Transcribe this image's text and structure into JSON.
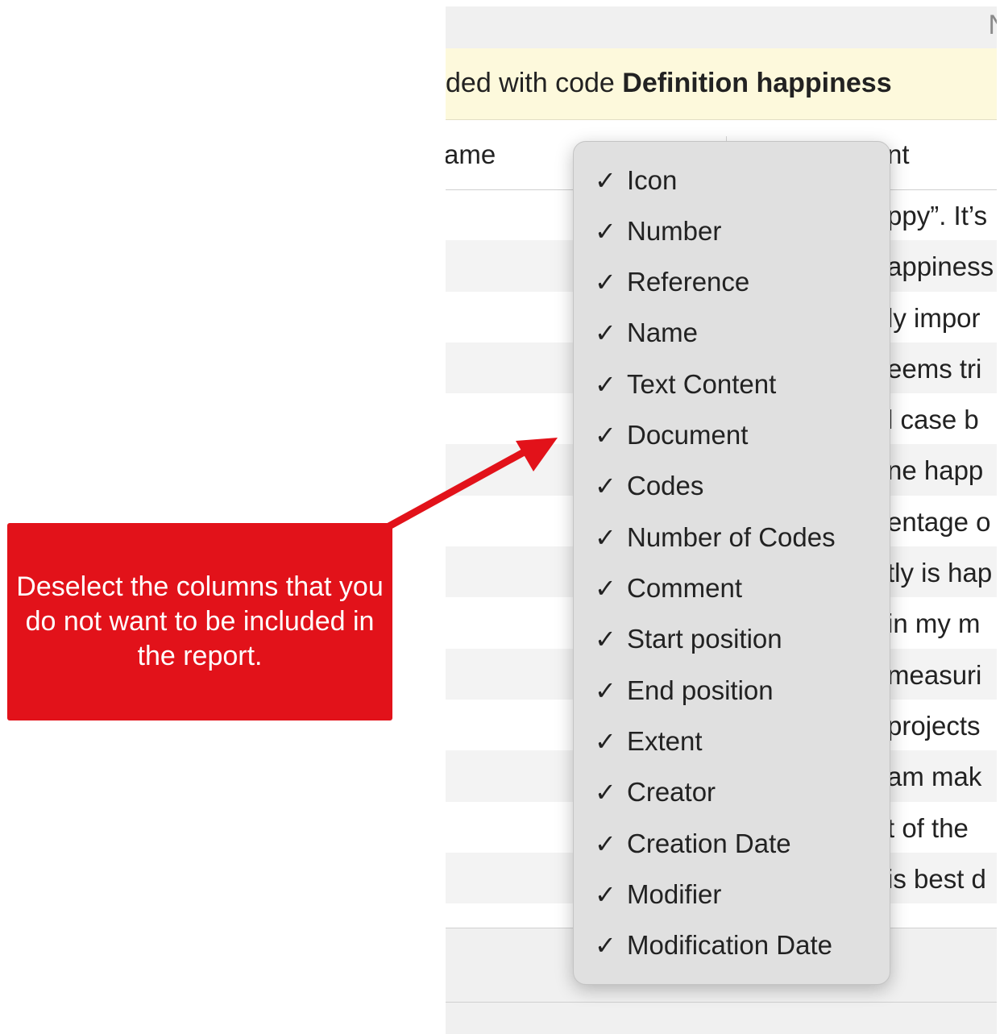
{
  "topbar": {
    "text": "N"
  },
  "banner": {
    "prefix": "ded with code ",
    "code_name": "Definition happiness"
  },
  "columns": {
    "name": "ame",
    "content": "nt"
  },
  "rows": [
    "ppy”. It’s",
    "appiness",
    "ly impor",
    "eems tri",
    "l case b",
    "ne happ",
    "entage o",
    "tly is hap",
    "in my m",
    "measuri",
    "projects",
    "am mak",
    "t of the",
    "is best d",
    ""
  ],
  "menu": {
    "check_glyph": "✓",
    "items": [
      "Icon",
      "Number",
      "Reference",
      "Name",
      "Text Content",
      "Document",
      "Codes",
      "Number of Codes",
      "Comment",
      "Start position",
      "End position",
      "Extent",
      "Creator",
      "Creation Date",
      "Modifier",
      "Modification Date"
    ]
  },
  "callout": {
    "text": "Deselect the columns that you do not want to be included in the report.",
    "color": "#e2121a"
  }
}
